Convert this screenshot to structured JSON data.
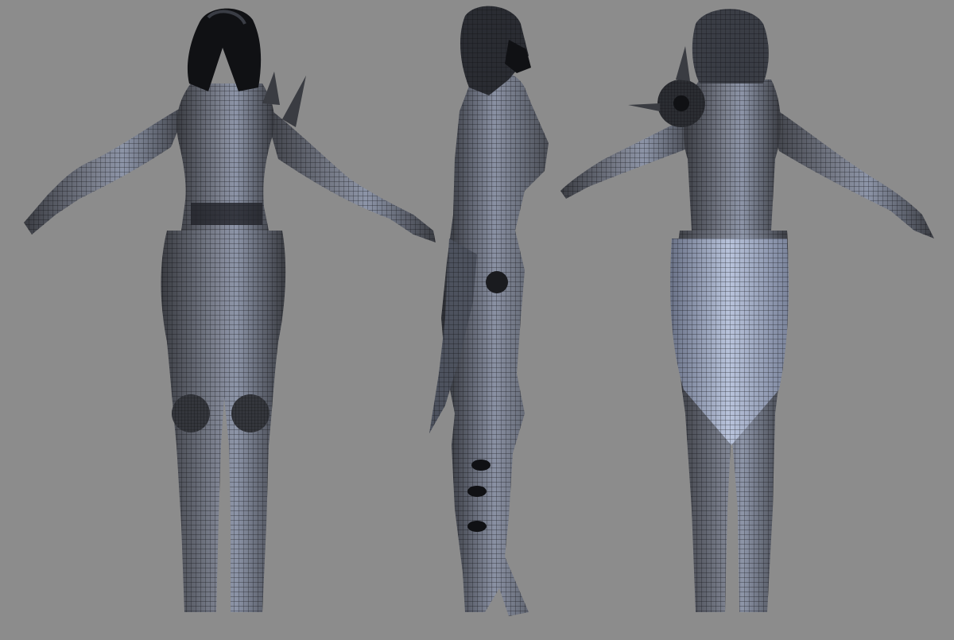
{
  "scene": {
    "background": "#8c8c8c",
    "mesh_fill": "#5e6068",
    "mesh_light": "#b9c4dc",
    "mesh_dark": "#23252a",
    "wire_color": "#0c0d10",
    "hair_color": "#101114",
    "views": [
      {
        "id": "front",
        "icon": "figure-front-icon"
      },
      {
        "id": "side",
        "icon": "figure-side-icon"
      },
      {
        "id": "back",
        "icon": "figure-back-icon"
      }
    ]
  }
}
